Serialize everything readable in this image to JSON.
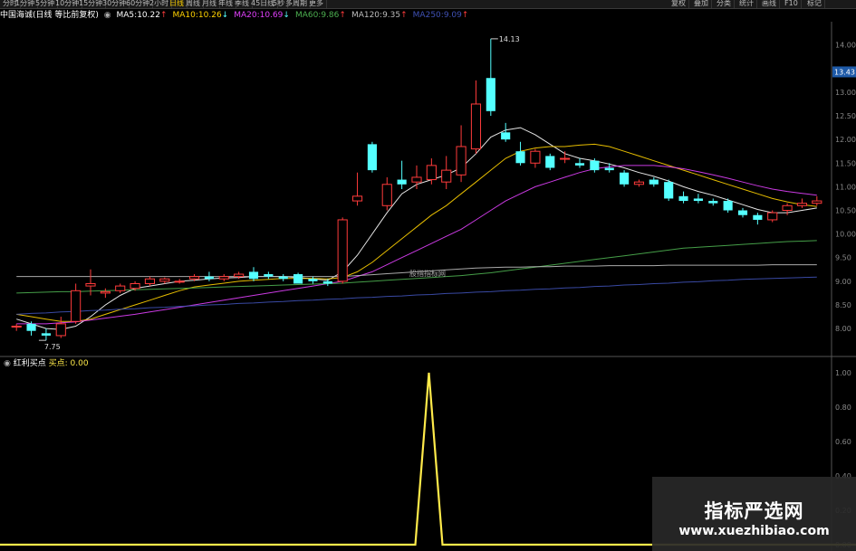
{
  "toolbar": {
    "left_items": [
      "分时",
      "1分钟",
      "5分钟",
      "10分钟",
      "15分钟",
      "30分钟",
      "60分钟",
      "2小时",
      "日线",
      "周线",
      "月线",
      "年线",
      "季线",
      "45日线",
      "5秒",
      "多周期",
      "更多"
    ],
    "active_index": 8,
    "right_items": [
      "复权",
      "叠加",
      "分类",
      "统计",
      "画线",
      "F10",
      "标记"
    ]
  },
  "header": {
    "stock_name": "中国海诚(日线 等比前复权)",
    "indicators": [
      {
        "label": "MA5:",
        "value": "10.22",
        "arrow": "↑",
        "color": "#ffffff"
      },
      {
        "label": "MA10:",
        "value": "10.26",
        "arrow": "↓",
        "color": "#ffd200"
      },
      {
        "label": "MA20:",
        "value": "10.69",
        "arrow": "↓",
        "color": "#e040fb"
      },
      {
        "label": "MA60:",
        "value": "9.86",
        "arrow": "↑",
        "color": "#4caf50"
      },
      {
        "label": "MA120:",
        "value": "9.35",
        "arrow": "↑",
        "color": "#bdbdbd"
      },
      {
        "label": "MA250:",
        "value": "9.09",
        "arrow": "↑",
        "color": "#3f51b5"
      }
    ]
  },
  "price_axis": {
    "labels": [
      "14.00",
      "13.43",
      "13.00",
      "12.50",
      "12.00",
      "11.50",
      "11.00",
      "10.50",
      "10.00",
      "9.50",
      "9.00",
      "8.50",
      "8.00"
    ],
    "current_price": "13.43"
  },
  "annotations": {
    "high": "14.13",
    "low": "7.75",
    "center_watermark": "股指指标网"
  },
  "sub_chart": {
    "indicator_name": "红利买点",
    "line_label": "买点:",
    "line_value": "0.00",
    "axis_labels": [
      "1.00",
      "0.80",
      "0.60",
      "0.40",
      "0.20",
      "0.00"
    ]
  },
  "watermark": {
    "title": "指标严选网",
    "url": "www.xuezhibiao.com"
  },
  "colors": {
    "up": "#ff3b3b",
    "down": "#54ffff",
    "ma5": "#ffffff",
    "ma10": "#ffd200",
    "ma20": "#e040fb",
    "ma60": "#4caf50",
    "ma120": "#bdbdbd",
    "ma250": "#3f51b5",
    "signal": "#ffea4a"
  },
  "chart_data": {
    "type": "candlestick",
    "y_range": [
      7.6,
      14.3
    ],
    "candles": [
      {
        "o": 8.05,
        "h": 8.1,
        "l": 7.95,
        "c": 8.05
      },
      {
        "o": 8.1,
        "h": 8.15,
        "l": 7.85,
        "c": 7.95
      },
      {
        "o": 7.9,
        "h": 8.0,
        "l": 7.75,
        "c": 7.85
      },
      {
        "o": 7.85,
        "h": 8.25,
        "l": 7.8,
        "c": 8.1
      },
      {
        "o": 8.15,
        "h": 8.95,
        "l": 8.1,
        "c": 8.8
      },
      {
        "o": 8.9,
        "h": 9.25,
        "l": 8.7,
        "c": 8.95
      },
      {
        "o": 8.75,
        "h": 8.85,
        "l": 8.65,
        "c": 8.78
      },
      {
        "o": 8.8,
        "h": 8.95,
        "l": 8.75,
        "c": 8.9
      },
      {
        "o": 8.85,
        "h": 9.0,
        "l": 8.8,
        "c": 8.95
      },
      {
        "o": 8.95,
        "h": 9.1,
        "l": 8.9,
        "c": 9.05
      },
      {
        "o": 9.0,
        "h": 9.08,
        "l": 8.95,
        "c": 9.05
      },
      {
        "o": 9.0,
        "h": 9.05,
        "l": 8.95,
        "c": 9.0
      },
      {
        "o": 9.05,
        "h": 9.15,
        "l": 9.0,
        "c": 9.1
      },
      {
        "o": 9.1,
        "h": 9.2,
        "l": 9.0,
        "c": 9.05
      },
      {
        "o": 9.05,
        "h": 9.15,
        "l": 9.0,
        "c": 9.1
      },
      {
        "o": 9.1,
        "h": 9.2,
        "l": 9.05,
        "c": 9.15
      },
      {
        "o": 9.2,
        "h": 9.3,
        "l": 9.0,
        "c": 9.05
      },
      {
        "o": 9.15,
        "h": 9.2,
        "l": 9.05,
        "c": 9.1
      },
      {
        "o": 9.1,
        "h": 9.15,
        "l": 9.0,
        "c": 9.05
      },
      {
        "o": 9.15,
        "h": 9.18,
        "l": 9.0,
        "c": 8.95
      },
      {
        "o": 9.05,
        "h": 9.1,
        "l": 8.95,
        "c": 9.0
      },
      {
        "o": 9.0,
        "h": 9.05,
        "l": 8.9,
        "c": 8.95
      },
      {
        "o": 9.0,
        "h": 10.35,
        "l": 8.95,
        "c": 10.3
      },
      {
        "o": 10.7,
        "h": 11.3,
        "l": 10.6,
        "c": 10.8
      },
      {
        "o": 11.9,
        "h": 11.95,
        "l": 11.3,
        "c": 11.35
      },
      {
        "o": 10.6,
        "h": 11.2,
        "l": 10.5,
        "c": 11.05
      },
      {
        "o": 11.15,
        "h": 11.55,
        "l": 10.95,
        "c": 11.05
      },
      {
        "o": 11.1,
        "h": 11.45,
        "l": 10.95,
        "c": 11.2
      },
      {
        "o": 11.15,
        "h": 11.6,
        "l": 11.05,
        "c": 11.45
      },
      {
        "o": 11.1,
        "h": 11.65,
        "l": 10.95,
        "c": 11.35
      },
      {
        "o": 11.25,
        "h": 12.3,
        "l": 11.1,
        "c": 11.85
      },
      {
        "o": 11.8,
        "h": 13.25,
        "l": 11.7,
        "c": 12.75
      },
      {
        "o": 13.3,
        "h": 14.13,
        "l": 12.5,
        "c": 12.6
      },
      {
        "o": 12.15,
        "h": 12.35,
        "l": 11.95,
        "c": 12.0
      },
      {
        "o": 11.75,
        "h": 11.95,
        "l": 11.45,
        "c": 11.5
      },
      {
        "o": 11.5,
        "h": 11.8,
        "l": 11.4,
        "c": 11.75
      },
      {
        "o": 11.65,
        "h": 11.7,
        "l": 11.35,
        "c": 11.4
      },
      {
        "o": 11.6,
        "h": 11.75,
        "l": 11.5,
        "c": 11.6
      },
      {
        "o": 11.5,
        "h": 11.6,
        "l": 11.4,
        "c": 11.45
      },
      {
        "o": 11.55,
        "h": 11.6,
        "l": 11.3,
        "c": 11.35
      },
      {
        "o": 11.4,
        "h": 11.5,
        "l": 11.3,
        "c": 11.35
      },
      {
        "o": 11.3,
        "h": 11.35,
        "l": 11.0,
        "c": 11.05
      },
      {
        "o": 11.05,
        "h": 11.15,
        "l": 11.0,
        "c": 11.1
      },
      {
        "o": 11.15,
        "h": 11.2,
        "l": 11.0,
        "c": 11.05
      },
      {
        "o": 11.1,
        "h": 11.15,
        "l": 10.7,
        "c": 10.75
      },
      {
        "o": 10.8,
        "h": 10.9,
        "l": 10.65,
        "c": 10.7
      },
      {
        "o": 10.75,
        "h": 10.85,
        "l": 10.65,
        "c": 10.7
      },
      {
        "o": 10.7,
        "h": 10.75,
        "l": 10.6,
        "c": 10.65
      },
      {
        "o": 10.7,
        "h": 10.75,
        "l": 10.45,
        "c": 10.5
      },
      {
        "o": 10.5,
        "h": 10.55,
        "l": 10.35,
        "c": 10.4
      },
      {
        "o": 10.4,
        "h": 10.45,
        "l": 10.2,
        "c": 10.3
      },
      {
        "o": 10.3,
        "h": 10.5,
        "l": 10.25,
        "c": 10.45
      },
      {
        "o": 10.5,
        "h": 10.65,
        "l": 10.4,
        "c": 10.6
      },
      {
        "o": 10.6,
        "h": 10.75,
        "l": 10.55,
        "c": 10.65
      },
      {
        "o": 10.65,
        "h": 10.8,
        "l": 10.6,
        "c": 10.7
      }
    ],
    "ma_lines": [
      {
        "name": "MA5",
        "values": [
          8.2,
          8.1,
          8.0,
          7.98,
          8.05,
          8.25,
          8.5,
          8.7,
          8.85,
          8.9,
          8.95,
          9.0,
          9.02,
          9.05,
          9.07,
          9.08,
          9.1,
          9.1,
          9.1,
          9.08,
          9.05,
          9.02,
          9.2,
          9.55,
          10.0,
          10.45,
          10.85,
          11.05,
          11.15,
          11.25,
          11.4,
          11.7,
          12.05,
          12.2,
          12.25,
          12.1,
          11.9,
          11.7,
          11.6,
          11.55,
          11.48,
          11.4,
          11.3,
          11.22,
          11.12,
          11.0,
          10.9,
          10.82,
          10.72,
          10.62,
          10.52,
          10.45,
          10.45,
          10.5,
          10.55
        ]
      },
      {
        "name": "MA10",
        "values": [
          8.3,
          8.25,
          8.2,
          8.15,
          8.15,
          8.2,
          8.3,
          8.4,
          8.5,
          8.6,
          8.7,
          8.8,
          8.88,
          8.92,
          8.96,
          9.0,
          9.02,
          9.04,
          9.06,
          9.06,
          9.06,
          9.05,
          9.08,
          9.2,
          9.4,
          9.65,
          9.9,
          10.15,
          10.4,
          10.6,
          10.85,
          11.1,
          11.35,
          11.6,
          11.75,
          11.82,
          11.85,
          11.85,
          11.88,
          11.9,
          11.85,
          11.75,
          11.65,
          11.55,
          11.45,
          11.35,
          11.25,
          11.15,
          11.05,
          10.95,
          10.85,
          10.75,
          10.68,
          10.62,
          10.58
        ]
      },
      {
        "name": "MA20",
        "values": [
          8.1,
          8.1,
          8.1,
          8.12,
          8.14,
          8.18,
          8.22,
          8.26,
          8.3,
          8.35,
          8.4,
          8.45,
          8.5,
          8.55,
          8.6,
          8.65,
          8.7,
          8.75,
          8.8,
          8.85,
          8.9,
          8.95,
          9.0,
          9.1,
          9.2,
          9.35,
          9.5,
          9.65,
          9.8,
          9.95,
          10.1,
          10.3,
          10.5,
          10.7,
          10.85,
          11.0,
          11.1,
          11.2,
          11.3,
          11.38,
          11.42,
          11.45,
          11.45,
          11.45,
          11.42,
          11.38,
          11.32,
          11.25,
          11.18,
          11.1,
          11.02,
          10.95,
          10.9,
          10.86,
          10.82
        ]
      },
      {
        "name": "MA60",
        "values": [
          8.75,
          8.76,
          8.77,
          8.78,
          8.78,
          8.79,
          8.8,
          8.81,
          8.82,
          8.83,
          8.84,
          8.85,
          8.86,
          8.87,
          8.88,
          8.89,
          8.9,
          8.91,
          8.92,
          8.93,
          8.94,
          8.95,
          8.96,
          8.98,
          9.0,
          9.02,
          9.04,
          9.06,
          9.08,
          9.1,
          9.12,
          9.15,
          9.18,
          9.22,
          9.26,
          9.3,
          9.34,
          9.38,
          9.42,
          9.46,
          9.5,
          9.54,
          9.58,
          9.62,
          9.66,
          9.7,
          9.72,
          9.74,
          9.76,
          9.78,
          9.8,
          9.82,
          9.84,
          9.85,
          9.86
        ]
      },
      {
        "name": "MA120",
        "values": [
          9.1,
          9.1,
          9.1,
          9.1,
          9.1,
          9.1,
          9.1,
          9.1,
          9.1,
          9.1,
          9.1,
          9.1,
          9.1,
          9.1,
          9.1,
          9.1,
          9.1,
          9.1,
          9.1,
          9.1,
          9.1,
          9.1,
          9.1,
          9.12,
          9.14,
          9.16,
          9.18,
          9.2,
          9.22,
          9.24,
          9.26,
          9.28,
          9.29,
          9.3,
          9.3,
          9.31,
          9.31,
          9.32,
          9.32,
          9.32,
          9.33,
          9.33,
          9.33,
          9.33,
          9.34,
          9.34,
          9.34,
          9.34,
          9.34,
          9.34,
          9.34,
          9.35,
          9.35,
          9.35,
          9.35
        ]
      },
      {
        "name": "MA250",
        "values": [
          8.3,
          8.32,
          8.33,
          8.35,
          8.36,
          8.38,
          8.39,
          8.41,
          8.42,
          8.44,
          8.45,
          8.47,
          8.48,
          8.5,
          8.51,
          8.53,
          8.54,
          8.56,
          8.57,
          8.59,
          8.6,
          8.62,
          8.63,
          8.65,
          8.66,
          8.68,
          8.69,
          8.71,
          8.72,
          8.74,
          8.75,
          8.77,
          8.78,
          8.8,
          8.81,
          8.83,
          8.84,
          8.86,
          8.87,
          8.89,
          8.9,
          8.92,
          8.93,
          8.95,
          8.96,
          8.98,
          8.99,
          9.01,
          9.02,
          9.04,
          9.05,
          9.06,
          9.07,
          9.08,
          9.09
        ]
      }
    ],
    "signal": [
      0,
      0,
      0,
      0,
      0,
      0,
      0,
      0,
      0,
      0,
      0,
      0,
      0,
      0,
      0,
      0,
      0,
      0,
      0,
      0,
      0,
      0,
      0,
      0,
      0,
      0,
      0,
      0,
      0,
      0,
      0,
      0,
      0,
      0,
      0,
      0,
      0,
      0,
      0,
      0,
      0,
      0,
      0,
      0,
      0,
      0,
      0,
      0,
      0,
      0,
      0,
      0,
      0,
      0,
      0
    ],
    "signal_peak": {
      "x_fraction": 0.515,
      "value": 1.0
    }
  }
}
